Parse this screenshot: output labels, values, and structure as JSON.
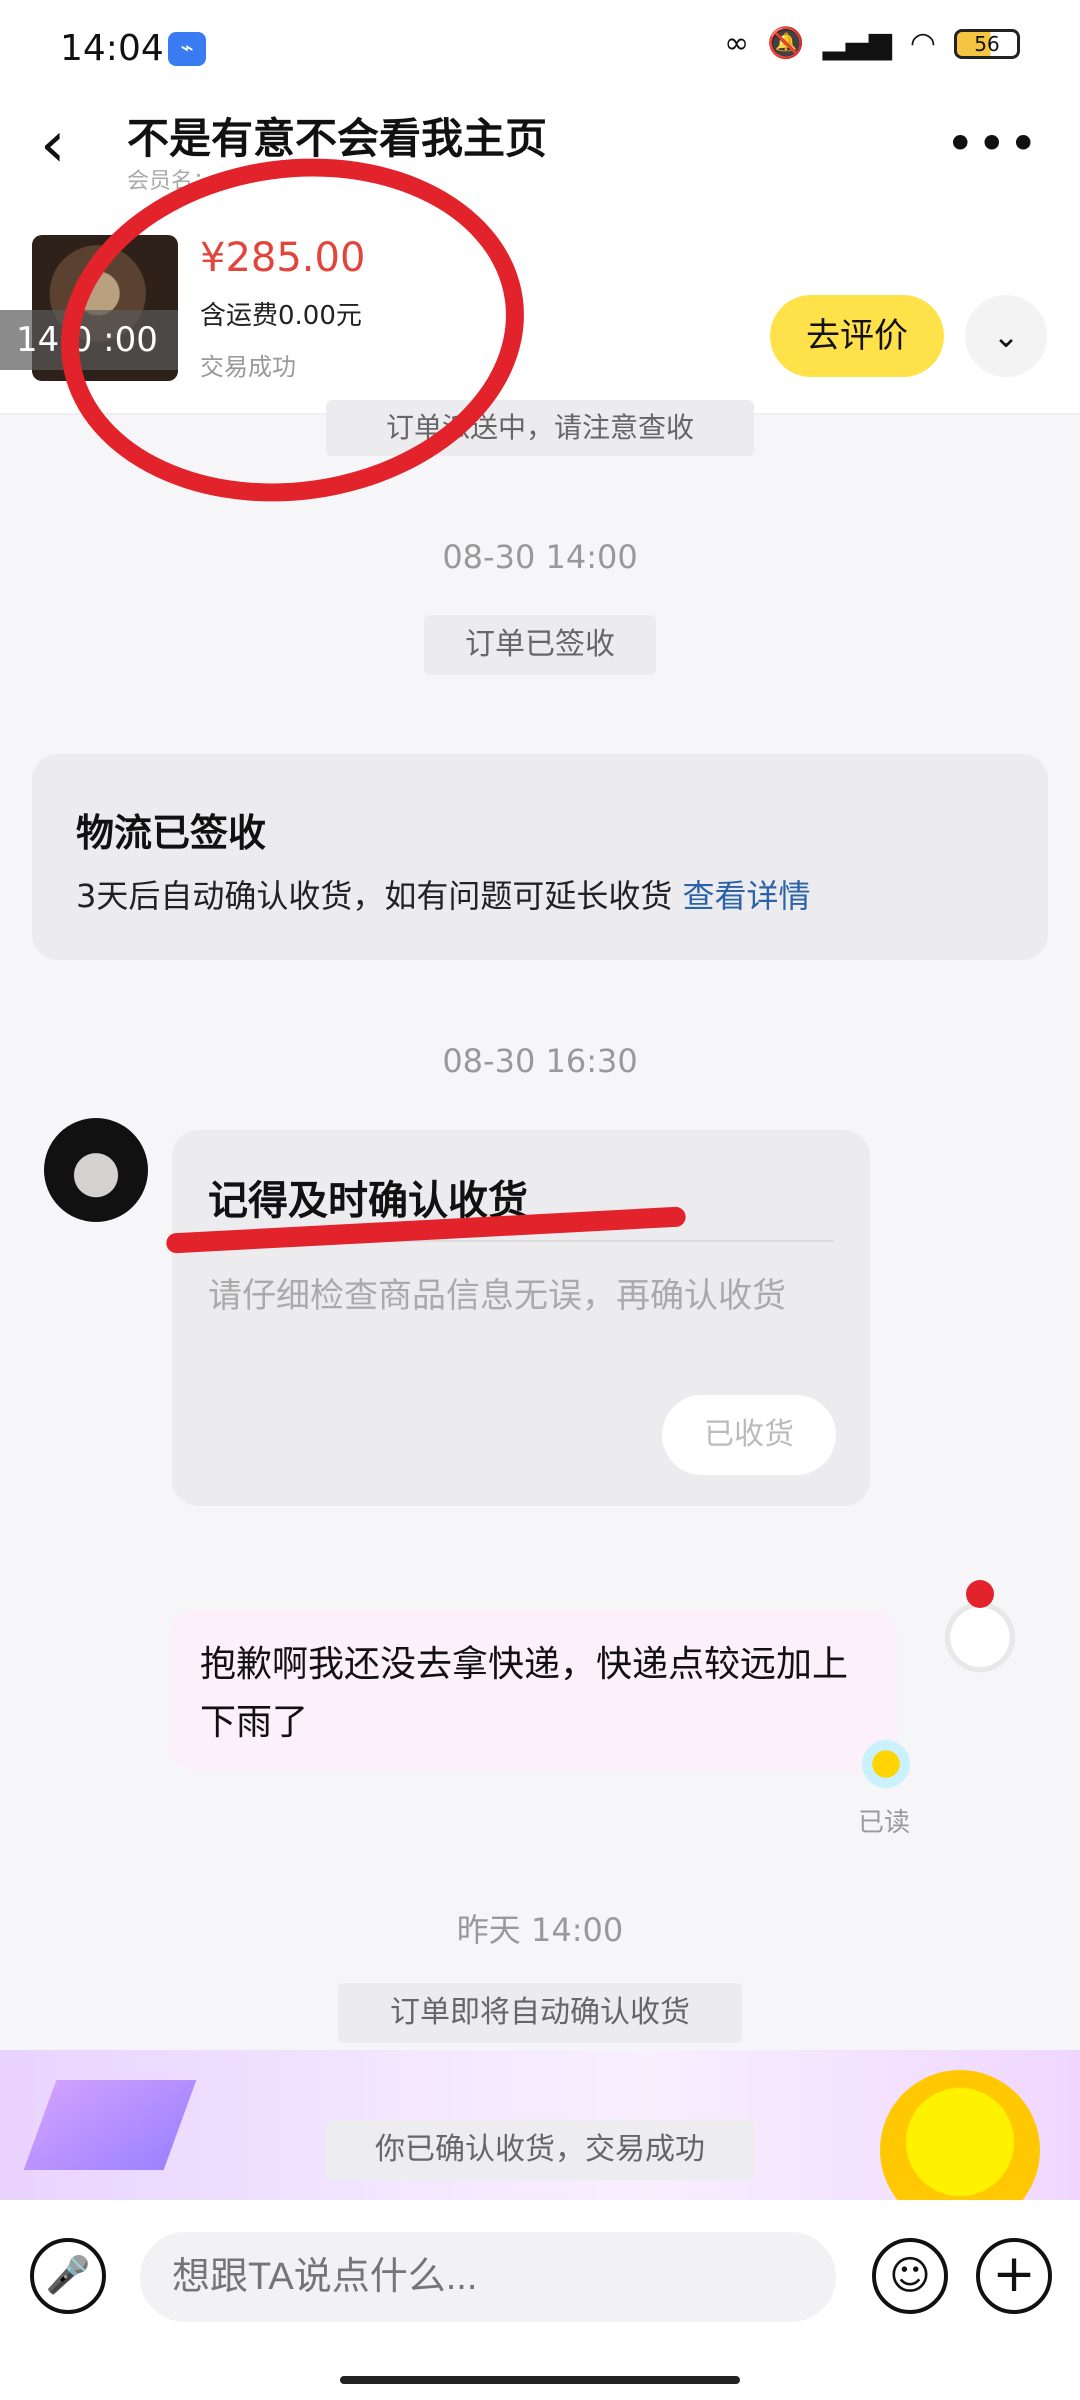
{
  "status_bar": {
    "time": "14:04",
    "battery": "56",
    "app_badge": "⌁",
    "icons": [
      "link-icon",
      "mute-icon",
      "signal-icon",
      "hd-signal-icon",
      "wifi-icon",
      "battery-icon"
    ]
  },
  "header": {
    "title": "不是有意不会看我主页",
    "subtitle": "会员名：x***",
    "back_icon": "‹",
    "more_icon": "•••"
  },
  "order": {
    "price": "¥285.00",
    "shipping": "含运费0.00元",
    "status": "交易成功",
    "thumb_time": "14:0 :00",
    "review_button": "去评价",
    "expand_icon": "⌄"
  },
  "messages": {
    "partial_notice": "订单派送中，请注意查收",
    "time1": "08-30 14:00",
    "signed_pill": "订单已签收",
    "logistics": {
      "title": "物流已签收",
      "text": "3天后自动确认收货，如有问题可延长收货",
      "link": "查看详情"
    },
    "time2": "08-30 16:30",
    "seller_card": {
      "title": "记得及时确认收货",
      "text": "请仔细检查商品信息无误，再确认收货",
      "button": "已收货"
    },
    "my_message": "抱歉啊我还没去拿快递，快递点较远加上下雨了",
    "read_label": "已读",
    "time3": "昨天 14:00",
    "auto_confirm_pill": "订单即将自动确认收货",
    "confirmed_pill": "你已确认收货，交易成功"
  },
  "input": {
    "placeholder": "想跟TA说点什么...",
    "mic_icon": "🎤",
    "emoji_icon": "☺",
    "plus_icon": "+"
  },
  "colors": {
    "price": "#e2453c",
    "review_button": "#ffe14a",
    "link": "#2c62a8",
    "annotation": "#e3232b"
  }
}
